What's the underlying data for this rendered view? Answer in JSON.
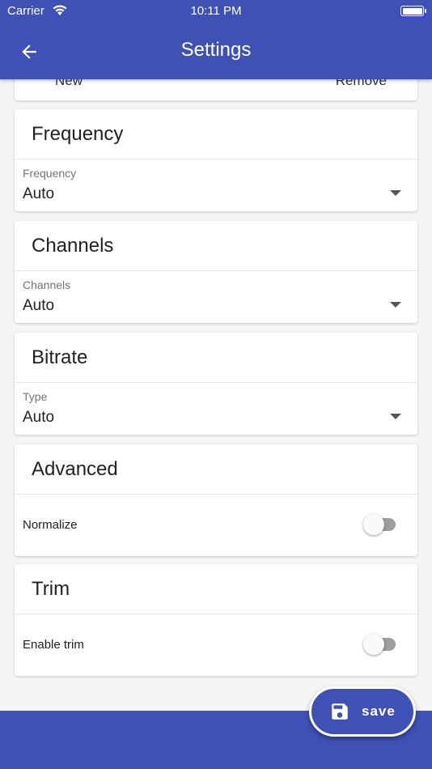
{
  "status_bar": {
    "carrier": "Carrier",
    "time": "10:11 PM"
  },
  "app_bar": {
    "title": "Settings",
    "back_icon": "arrow-left-icon"
  },
  "partial_card": {
    "left_text": "New",
    "right_text": "Remove"
  },
  "cards": {
    "frequency": {
      "title": "Frequency",
      "label": "Frequency",
      "value": "Auto"
    },
    "channels": {
      "title": "Channels",
      "label": "Channels",
      "value": "Auto"
    },
    "bitrate": {
      "title": "Bitrate",
      "label": "Type",
      "value": "Auto"
    },
    "advanced": {
      "title": "Advanced",
      "toggle_label": "Normalize",
      "toggle_on": false
    },
    "trim": {
      "title": "Trim",
      "toggle_label": "Enable trim",
      "toggle_on": false
    }
  },
  "fab": {
    "label": "save",
    "icon": "floppy-disk-icon"
  },
  "colors": {
    "primary": "#3f51b5",
    "background": "#f5f5f5",
    "card": "#ffffff"
  }
}
